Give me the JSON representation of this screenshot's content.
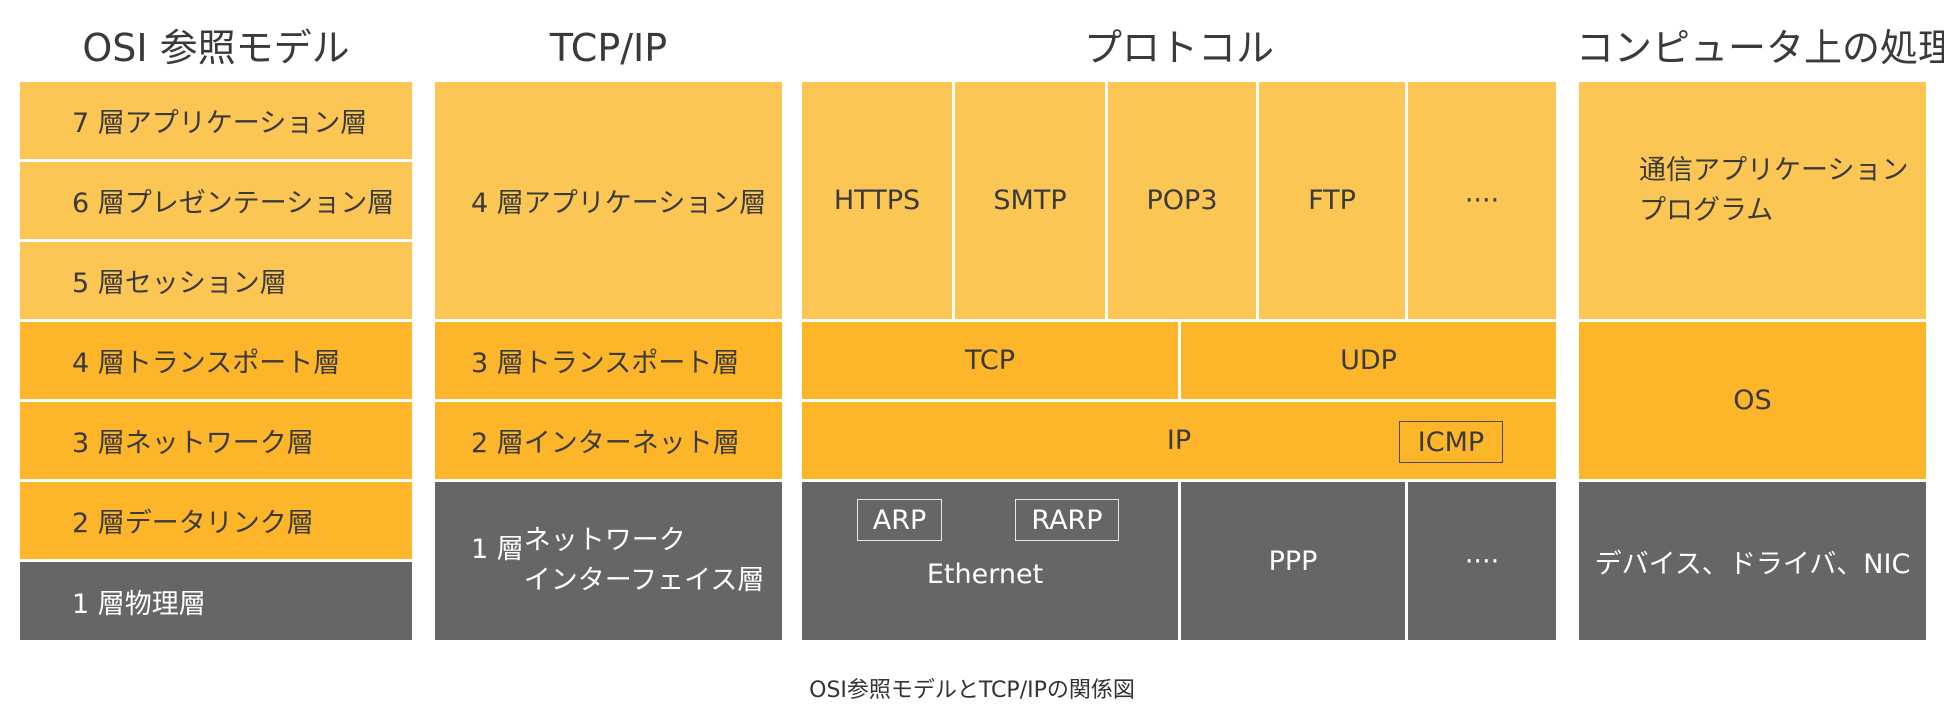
{
  "headings": {
    "osi": "OSI 参照モデル",
    "tcpip": "TCP/IP",
    "protocol": "プロトコル",
    "computer": "コンピュータ上の処理"
  },
  "osi_layers": [
    {
      "num": "7 層",
      "name": "アプリケーション層"
    },
    {
      "num": "6 層",
      "name": "プレゼンテーション層"
    },
    {
      "num": "5 層",
      "name": "セッション層"
    },
    {
      "num": "4 層",
      "name": "トランスポート層"
    },
    {
      "num": "3 層",
      "name": "ネットワーク層"
    },
    {
      "num": "2 層",
      "name": "データリンク層"
    },
    {
      "num": "1 層",
      "name": "物理層"
    }
  ],
  "tcpip_layers": [
    {
      "num": "4 層",
      "name": "アプリケーション層"
    },
    {
      "num": "3 層",
      "name": "トランスポート層"
    },
    {
      "num": "2 層",
      "name": "インターネット層"
    },
    {
      "num": "1 層",
      "name_line1": "ネットワーク",
      "name_line2": "インターフェイス層"
    }
  ],
  "protocols": {
    "application": [
      "HTTPS",
      "SMTP",
      "POP3",
      "FTP",
      "····"
    ],
    "transport": [
      "TCP",
      "UDP"
    ],
    "internet": "IP",
    "internet_boxed": "ICMP",
    "link_boxed": [
      "ARP",
      "RARP"
    ],
    "link": [
      "Ethernet",
      "PPP",
      "····"
    ]
  },
  "computer": {
    "app_line1": "通信アプリケーション",
    "app_line2": "プログラム",
    "os": "OS",
    "hardware": "デバイス、ドライバ、NIC"
  },
  "caption": "OSI参照モデルとTCP/IPの関係図",
  "colors": {
    "light_orange": "#fcc655",
    "orange": "#fdb52a",
    "gray": "#666666"
  }
}
